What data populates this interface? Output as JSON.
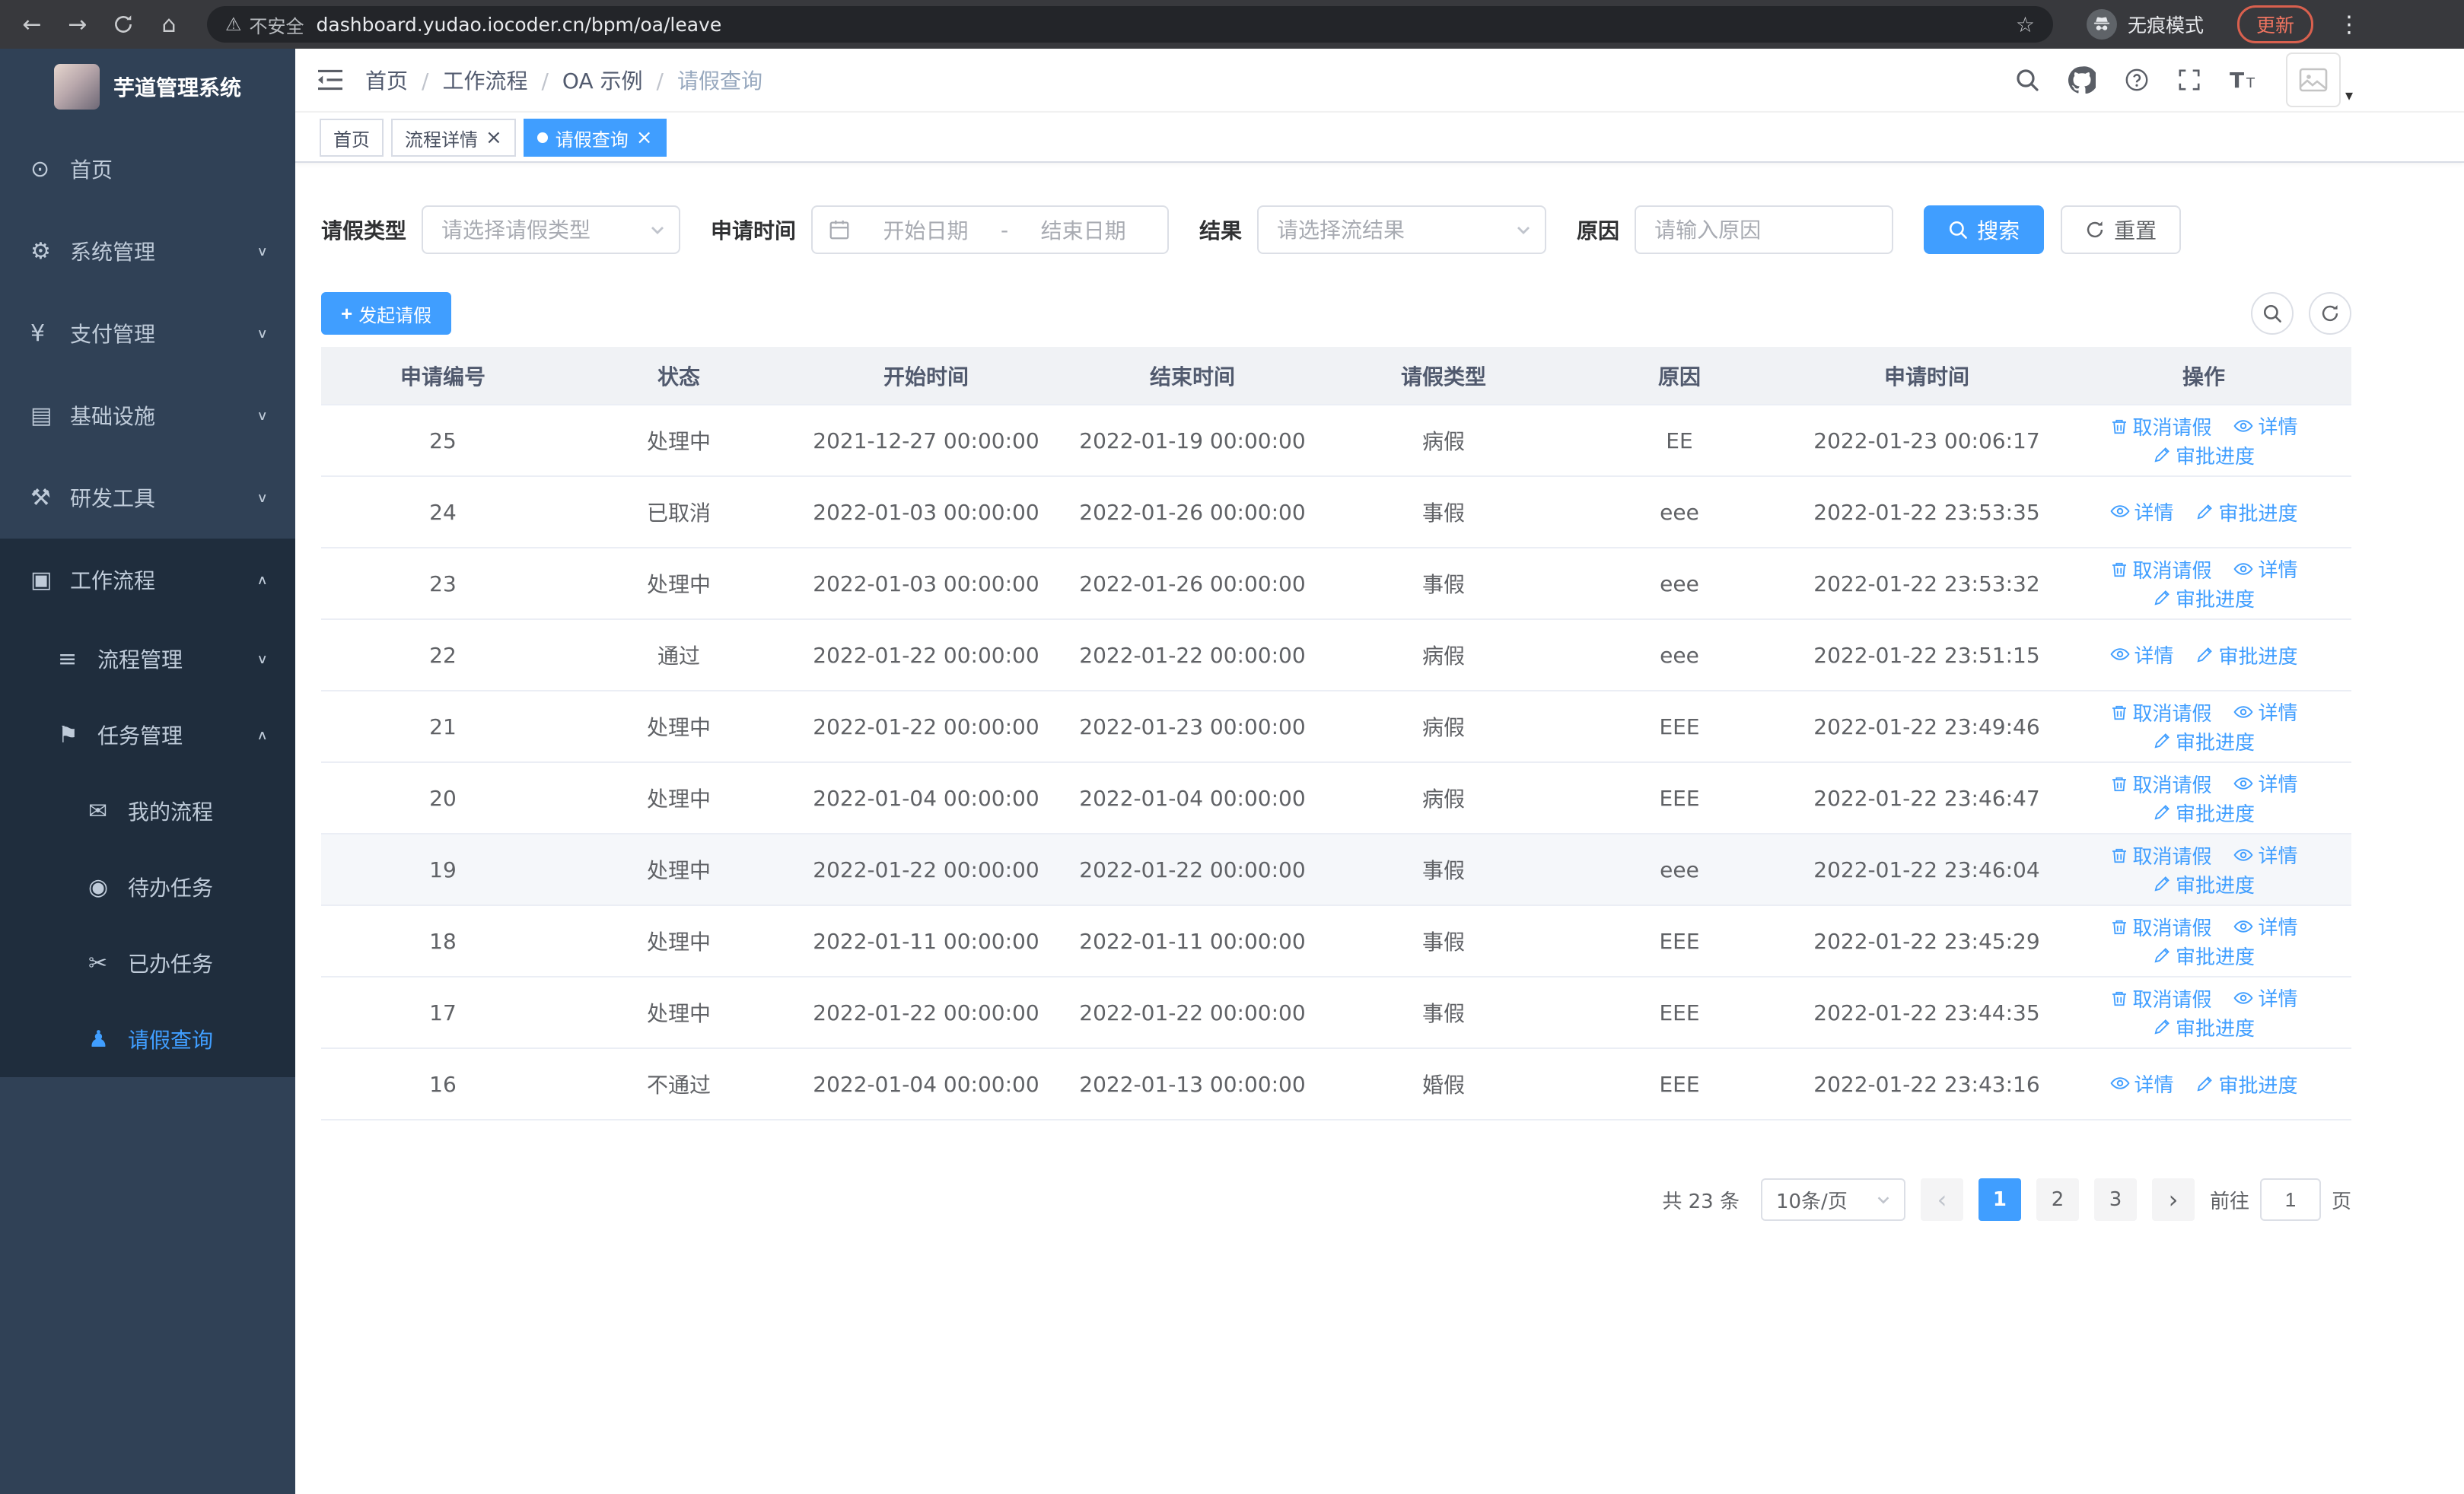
{
  "browser": {
    "security_warning": "不安全",
    "url": "dashboard.yudao.iocoder.cn/bpm/oa/leave",
    "incognito_label": "无痕模式",
    "update_label": "更新"
  },
  "sidebar": {
    "app_title": "芋道管理系统",
    "items": [
      {
        "label": "首页",
        "icon": "dashboard-icon",
        "level": 1
      },
      {
        "label": "系统管理",
        "icon": "gear-icon",
        "level": 1,
        "chevron": "down"
      },
      {
        "label": "支付管理",
        "icon": "yen-icon",
        "level": 1,
        "chevron": "down"
      },
      {
        "label": "基础设施",
        "icon": "infra-icon",
        "level": 1,
        "chevron": "down"
      },
      {
        "label": "研发工具",
        "icon": "tools-icon",
        "level": 1,
        "chevron": "down"
      },
      {
        "label": "工作流程",
        "icon": "workflow-icon",
        "level": 1,
        "chevron": "up",
        "dark": true
      },
      {
        "label": "流程管理",
        "icon": "process-icon",
        "level": 2,
        "chevron": "down",
        "dark": true
      },
      {
        "label": "任务管理",
        "icon": "task-icon",
        "level": 2,
        "chevron": "up",
        "dark": true
      },
      {
        "label": "我的流程",
        "icon": "chat-icon",
        "level": 3,
        "dark": true
      },
      {
        "label": "待办任务",
        "icon": "eye-icon",
        "level": 3,
        "dark": true
      },
      {
        "label": "已办任务",
        "icon": "done-icon",
        "level": 3,
        "dark": true
      },
      {
        "label": "请假查询",
        "icon": "user-icon",
        "level": 3,
        "dark": true,
        "active": true
      }
    ]
  },
  "navbar": {
    "breadcrumbs": [
      {
        "label": "首页"
      },
      {
        "label": "工作流程"
      },
      {
        "label": "OA 示例"
      },
      {
        "label": "请假查询",
        "last": true
      }
    ]
  },
  "tabs": [
    {
      "label": "首页"
    },
    {
      "label": "流程详情",
      "closable": true
    },
    {
      "label": "请假查询",
      "closable": true,
      "active": true
    }
  ],
  "filters": {
    "leave_type_label": "请假类型",
    "leave_type_placeholder": "请选择请假类型",
    "apply_time_label": "申请时间",
    "start_date_placeholder": "开始日期",
    "date_separator": "-",
    "end_date_placeholder": "结束日期",
    "result_label": "结果",
    "result_placeholder": "请选择流结果",
    "reason_label": "原因",
    "reason_placeholder": "请输入原因",
    "search_label": "搜索",
    "reset_label": "重置"
  },
  "toolbar": {
    "create_label": "发起请假"
  },
  "table": {
    "columns": [
      "申请编号",
      "状态",
      "开始时间",
      "结束时间",
      "请假类型",
      "原因",
      "申请时间",
      "操作"
    ],
    "actions": {
      "cancel": "取消请假",
      "detail": "详情",
      "progress": "审批进度"
    },
    "rows": [
      {
        "id": "25",
        "status": "处理中",
        "start": "2021-12-27 00:00:00",
        "end": "2022-01-19 00:00:00",
        "type": "病假",
        "reason": "EE",
        "applied": "2022-01-23 00:06:17",
        "can_cancel": true
      },
      {
        "id": "24",
        "status": "已取消",
        "start": "2022-01-03 00:00:00",
        "end": "2022-01-26 00:00:00",
        "type": "事假",
        "reason": "eee",
        "applied": "2022-01-22 23:53:35",
        "can_cancel": false
      },
      {
        "id": "23",
        "status": "处理中",
        "start": "2022-01-03 00:00:00",
        "end": "2022-01-26 00:00:00",
        "type": "事假",
        "reason": "eee",
        "applied": "2022-01-22 23:53:32",
        "can_cancel": true
      },
      {
        "id": "22",
        "status": "通过",
        "start": "2022-01-22 00:00:00",
        "end": "2022-01-22 00:00:00",
        "type": "病假",
        "reason": "eee",
        "applied": "2022-01-22 23:51:15",
        "can_cancel": false
      },
      {
        "id": "21",
        "status": "处理中",
        "start": "2022-01-22 00:00:00",
        "end": "2022-01-23 00:00:00",
        "type": "病假",
        "reason": "EEE",
        "applied": "2022-01-22 23:49:46",
        "can_cancel": true
      },
      {
        "id": "20",
        "status": "处理中",
        "start": "2022-01-04 00:00:00",
        "end": "2022-01-04 00:00:00",
        "type": "病假",
        "reason": "EEE",
        "applied": "2022-01-22 23:46:47",
        "can_cancel": true
      },
      {
        "id": "19",
        "status": "处理中",
        "start": "2022-01-22 00:00:00",
        "end": "2022-01-22 00:00:00",
        "type": "事假",
        "reason": "eee",
        "applied": "2022-01-22 23:46:04",
        "can_cancel": true,
        "hover": true
      },
      {
        "id": "18",
        "status": "处理中",
        "start": "2022-01-11 00:00:00",
        "end": "2022-01-11 00:00:00",
        "type": "事假",
        "reason": "EEE",
        "applied": "2022-01-22 23:45:29",
        "can_cancel": true
      },
      {
        "id": "17",
        "status": "处理中",
        "start": "2022-01-22 00:00:00",
        "end": "2022-01-22 00:00:00",
        "type": "事假",
        "reason": "EEE",
        "applied": "2022-01-22 23:44:35",
        "can_cancel": true
      },
      {
        "id": "16",
        "status": "不通过",
        "start": "2022-01-04 00:00:00",
        "end": "2022-01-13 00:00:00",
        "type": "婚假",
        "reason": "EEE",
        "applied": "2022-01-22 23:43:16",
        "can_cancel": false
      }
    ]
  },
  "pagination": {
    "total_label": "共 23 条",
    "page_size": "10条/页",
    "pages": [
      {
        "num": "1",
        "active": true
      },
      {
        "num": "2"
      },
      {
        "num": "3"
      }
    ],
    "goto_label": "前往",
    "goto_value": "1",
    "page_label": "页"
  },
  "colors": {
    "primary": "#409eff",
    "sidebar_bg": "#304156",
    "sidebar_submenu_bg": "#1f2d3d",
    "table_header_bg": "#f0f2f5"
  }
}
